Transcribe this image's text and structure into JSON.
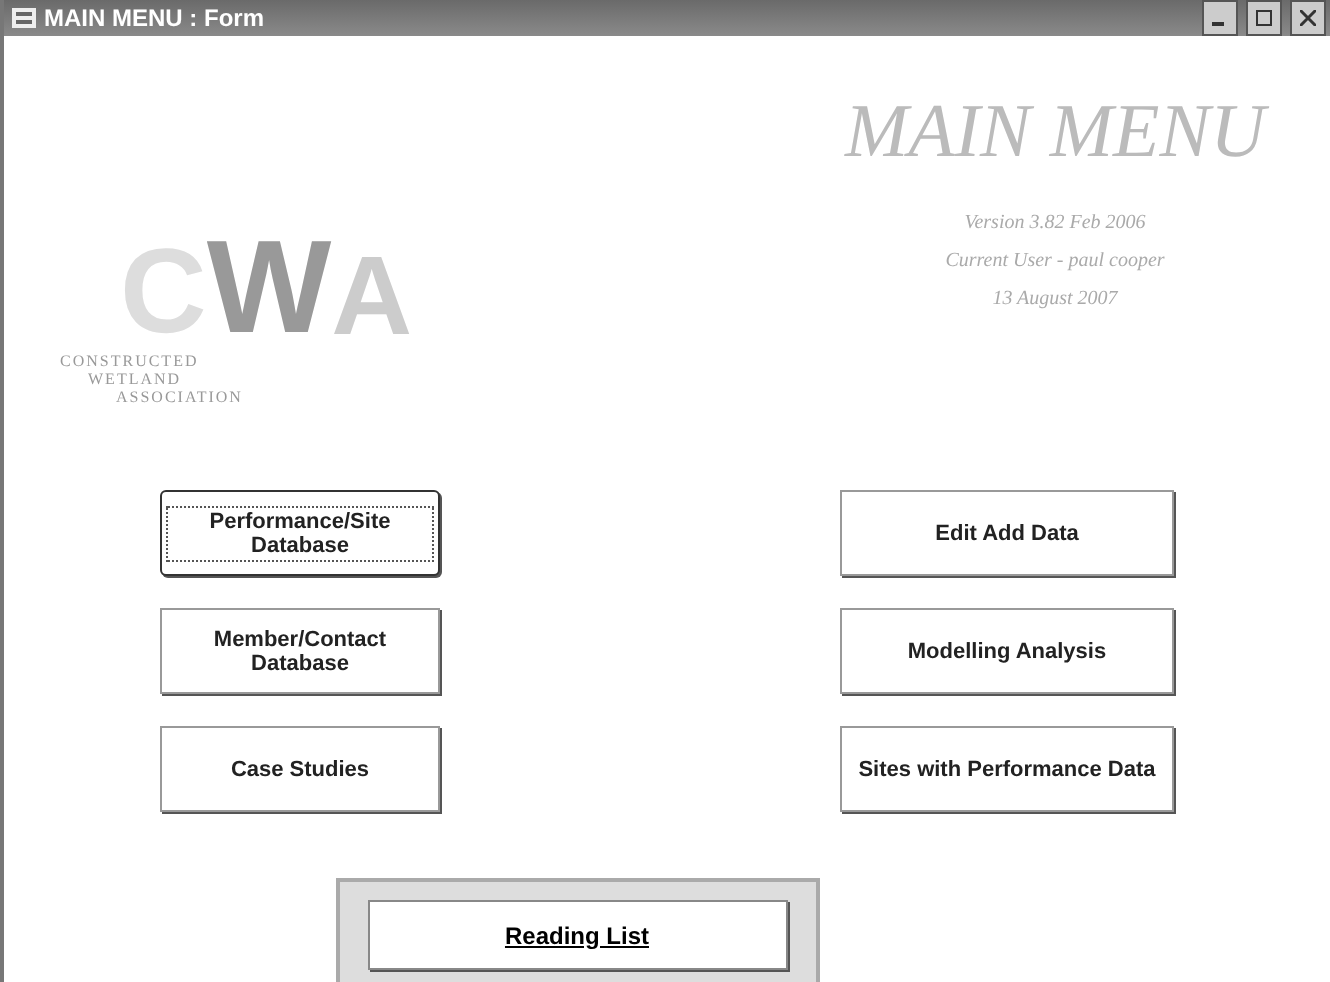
{
  "window": {
    "title": "MAIN MENU : Form"
  },
  "logo": {
    "letters": [
      "C",
      "W",
      "A"
    ],
    "caption": [
      "CONSTRUCTED",
      "WETLAND",
      "ASSOCIATION"
    ]
  },
  "header": {
    "title": "MAIN MENU",
    "lines": [
      "Version 3.82 Feb 2006",
      "Current User - paul cooper",
      "13 August 2007"
    ]
  },
  "left_buttons": [
    {
      "label": "Performance/Site Database",
      "focused": true
    },
    {
      "label": "Member/Contact Database",
      "focused": false
    },
    {
      "label": "Case Studies",
      "focused": false
    }
  ],
  "right_buttons": [
    {
      "label": "Edit Add Data",
      "focused": false
    },
    {
      "label": "Modelling Analysis",
      "focused": false
    },
    {
      "label": "Sites with Performance Data",
      "focused": false
    }
  ],
  "reading_list": {
    "label": "Reading List",
    "underlined": true
  }
}
